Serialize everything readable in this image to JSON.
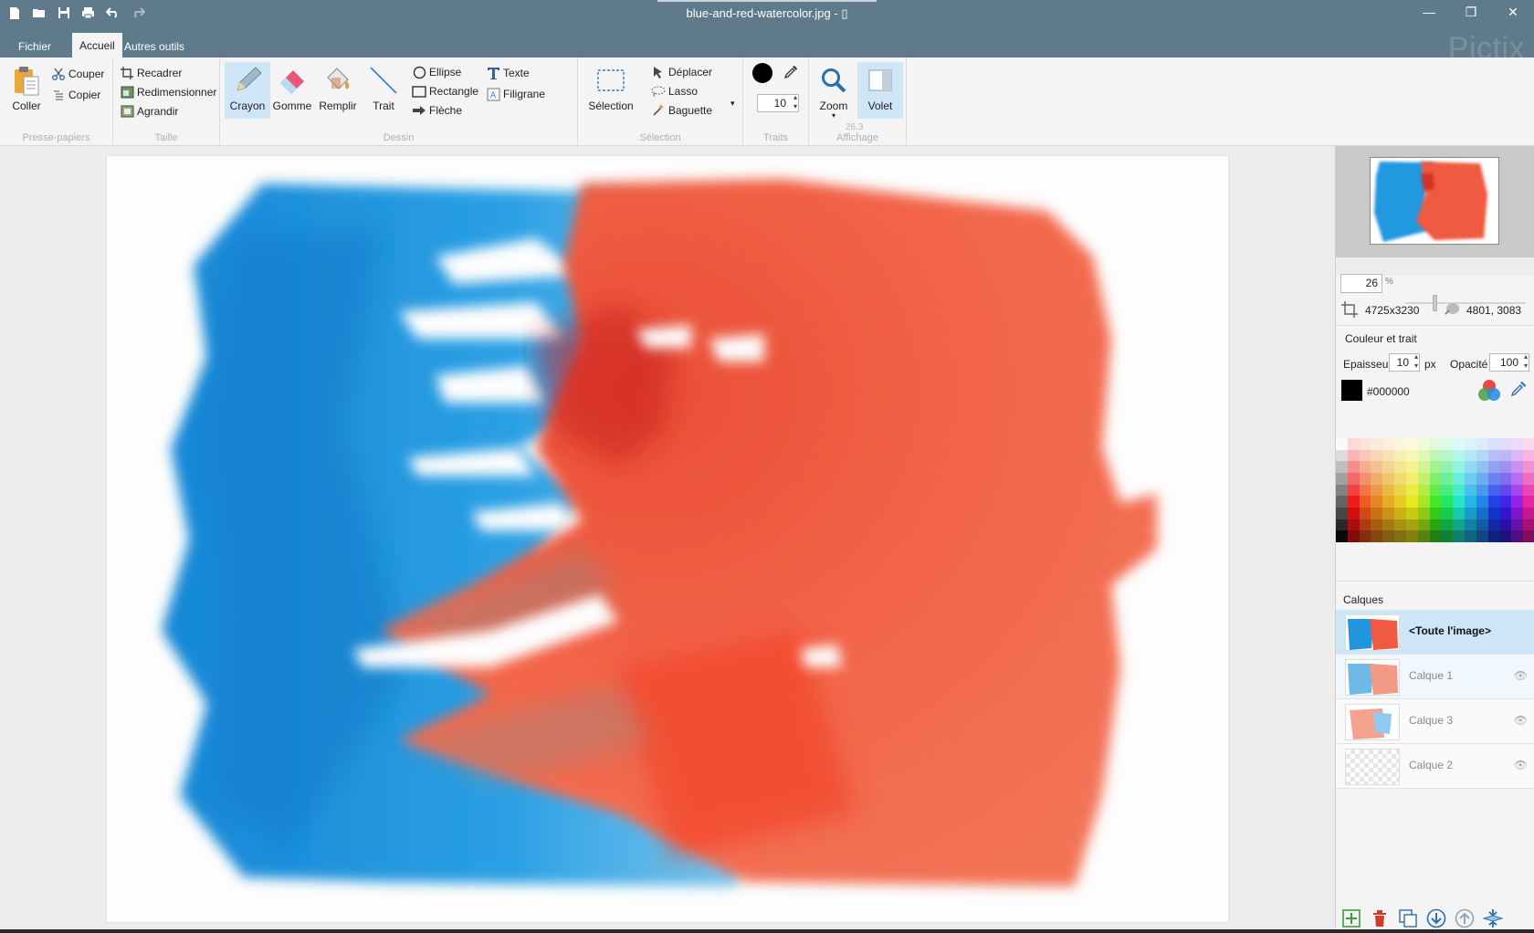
{
  "window": {
    "title": "blue-and-red-watercolor.jpg - ",
    "brand": "Pictix",
    "quick_access": [
      "new-file-icon",
      "open-folder-icon",
      "save-icon",
      "print-icon",
      "undo-icon",
      "redo-icon"
    ],
    "controls": [
      "minimize-icon",
      "restore-icon",
      "close-icon"
    ]
  },
  "tabs": [
    {
      "label": "Fichier",
      "active": false
    },
    {
      "label": "Accueil",
      "active": true
    },
    {
      "label": "Autres outils",
      "active": false
    }
  ],
  "ribbon": {
    "clipboard": {
      "label": "Presse-papiers",
      "paste": "Coller",
      "cut": "Couper",
      "copy": "Copier"
    },
    "size": {
      "label": "Taille",
      "crop": "Recadrer",
      "resize": "Redimensionner",
      "enlarge": "Agrandir"
    },
    "draw": {
      "label": "Dessin",
      "pencil": "Crayon",
      "eraser": "Gomme",
      "fill": "Remplir",
      "line": "Trait",
      "ellipse": "Ellipse",
      "rectangle": "Rectangle",
      "arrow": "Flèche",
      "text": "Texte",
      "watermark": "Filigrane"
    },
    "selection": {
      "label": "Sélection",
      "select": "Sélection",
      "move": "Déplacer",
      "lasso": "Lasso",
      "wand": "Baguette"
    },
    "strokes": {
      "label": "Traits",
      "size": "10"
    },
    "view": {
      "label": "Affichage",
      "zoom": "Zoom",
      "zoom_value": "26.3",
      "panel": "Volet"
    }
  },
  "panel": {
    "zoom_value": "26",
    "zoom_unit": "%",
    "image_size": "4725x3230",
    "cursor_pos": "4801, 3083",
    "color_section": "Couleur et trait",
    "thickness_label": "Epaisseur",
    "thickness": "10",
    "thickness_unit": "px",
    "opacity_label": "Opacité",
    "opacity": "100",
    "color_hex": "#000000",
    "layers_title": "Calques",
    "layers": [
      {
        "name": "<Toute l'image>"
      },
      {
        "name": "Calque 1"
      },
      {
        "name": "Calque 3"
      },
      {
        "name": "Calque 2"
      }
    ]
  },
  "colors": {
    "titlebar": "#5f7b8b",
    "selection": "#cfe6f7",
    "blue_paint": "#1a8fdc",
    "red_paint": "#f2503a",
    "current_color": "#000000"
  }
}
